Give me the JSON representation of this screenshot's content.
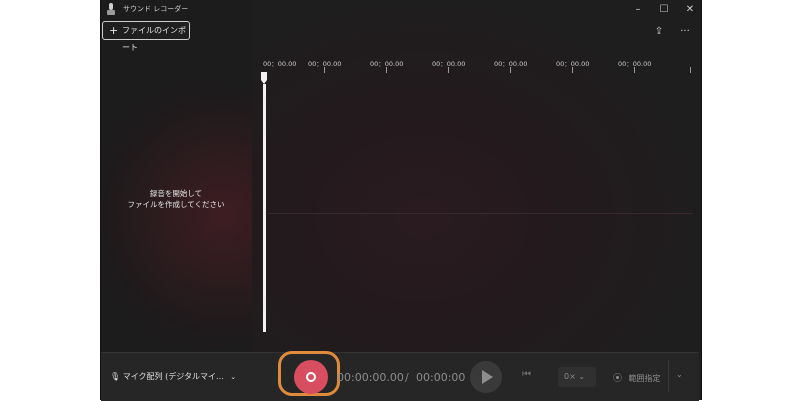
{
  "window": {
    "title": "サウンド レコーダー",
    "minimize": "–",
    "maximize": "☐",
    "close": "✕"
  },
  "toolbar": {
    "import_label": "ファイルのインポート",
    "import_plus": "+",
    "share_icon": "⇪",
    "more_icon": "···"
  },
  "timeline": {
    "ruler_labels": [
      "00：00.00",
      "00：00.00",
      "00：00.00",
      "00：00.00",
      "00：00.00",
      "00：00.00",
      "00：00.00"
    ]
  },
  "empty_state": {
    "line1": "録音を開始して",
    "line2": "ファイルを作成してください"
  },
  "controls": {
    "mic_label": "マイク配列 (デジタルマイ...",
    "mic_chevron": "⌄",
    "current_time": "00:00:00.00",
    "separator": "/",
    "total_time": "00:00:00",
    "skip_icon": "⏮",
    "speed_label": "0× ⌄",
    "range_label": "範囲指定",
    "range_icon": "⦿",
    "expand_icon": "⌄"
  },
  "colors": {
    "record": "#d84d60",
    "highlight_ring": "#e08a3c",
    "background": "#1f1f1f"
  }
}
